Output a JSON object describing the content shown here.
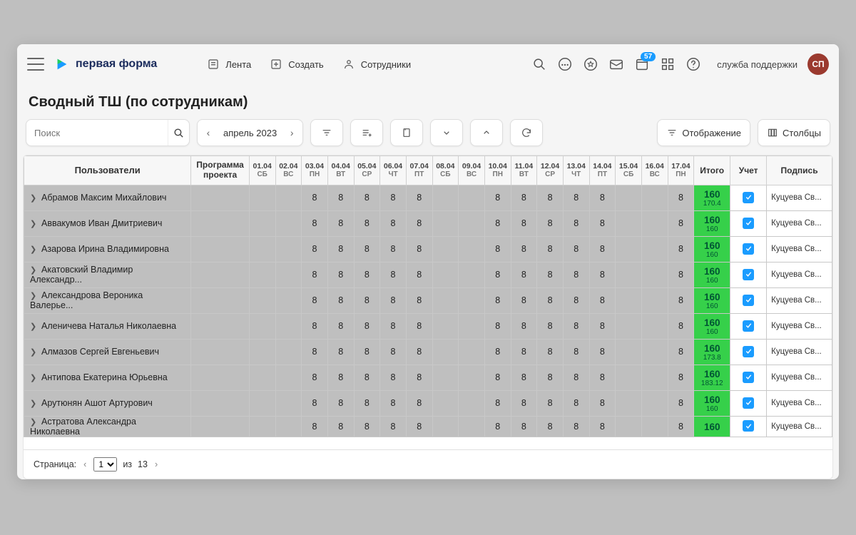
{
  "brand": "первая форма",
  "nav": {
    "feed": "Лента",
    "create": "Создать",
    "employees": "Сотрудники"
  },
  "badge_count": "57",
  "user": {
    "label": "служба поддержки",
    "initials": "СП"
  },
  "page_title": "Сводный ТШ (по сотрудникам)",
  "search": {
    "placeholder": "Поиск"
  },
  "period": {
    "label": "апрель 2023"
  },
  "toolbar": {
    "display": "Отображение",
    "columns": "Столбцы"
  },
  "columns": {
    "users": "Пользователи",
    "program": "Программа проекта",
    "itogo": "Итого",
    "uchet": "Учет",
    "sign": "Подпись"
  },
  "days": [
    {
      "d": "01.04",
      "w": "СБ"
    },
    {
      "d": "02.04",
      "w": "ВС"
    },
    {
      "d": "03.04",
      "w": "ПН"
    },
    {
      "d": "04.04",
      "w": "ВТ"
    },
    {
      "d": "05.04",
      "w": "СР"
    },
    {
      "d": "06.04",
      "w": "ЧТ"
    },
    {
      "d": "07.04",
      "w": "ПТ"
    },
    {
      "d": "08.04",
      "w": "СБ"
    },
    {
      "d": "09.04",
      "w": "ВС"
    },
    {
      "d": "10.04",
      "w": "ПН"
    },
    {
      "d": "11.04",
      "w": "ВТ"
    },
    {
      "d": "12.04",
      "w": "СР"
    },
    {
      "d": "13.04",
      "w": "ЧТ"
    },
    {
      "d": "14.04",
      "w": "ПТ"
    },
    {
      "d": "15.04",
      "w": "СБ"
    },
    {
      "d": "16.04",
      "w": "ВС"
    },
    {
      "d": "17.04",
      "w": "ПН"
    }
  ],
  "day_value": "8",
  "work_idx": [
    2,
    3,
    4,
    5,
    6,
    9,
    10,
    11,
    12,
    13,
    16
  ],
  "rows": [
    {
      "name": "Абрамов Максим Михайлович",
      "itogo": "160",
      "sub": "170.4",
      "sign": "Куцуева Св..."
    },
    {
      "name": "Аввакумов Иван Дмитриевич",
      "itogo": "160",
      "sub": "160",
      "sign": "Куцуева Св..."
    },
    {
      "name": "Азарова Ирина Владимировна",
      "itogo": "160",
      "sub": "160",
      "sign": "Куцуева Св..."
    },
    {
      "name": "Акатовский Владимир Александр...",
      "itogo": "160",
      "sub": "160",
      "sign": "Куцуева Св..."
    },
    {
      "name": "Александрова Вероника Валерье...",
      "itogo": "160",
      "sub": "160",
      "sign": "Куцуева Св..."
    },
    {
      "name": "Аленичева Наталья Николаевна",
      "itogo": "160",
      "sub": "160",
      "sign": "Куцуева Св..."
    },
    {
      "name": "Алмазов Сергей Евгеньевич",
      "itogo": "160",
      "sub": "173.8",
      "sign": "Куцуева Св..."
    },
    {
      "name": "Антипова Екатерина Юрьевна",
      "itogo": "160",
      "sub": "183.12",
      "sign": "Куцуева Св..."
    },
    {
      "name": "Арутюнян Ашот Артурович",
      "itogo": "160",
      "sub": "160",
      "sign": "Куцуева Св..."
    },
    {
      "name": "Астратова Александра Николаевна",
      "itogo": "160",
      "sub": "",
      "sign": "Куцуева Св..."
    }
  ],
  "pager": {
    "label": "Страница:",
    "current": "1",
    "of_label": "из",
    "total": "13"
  }
}
